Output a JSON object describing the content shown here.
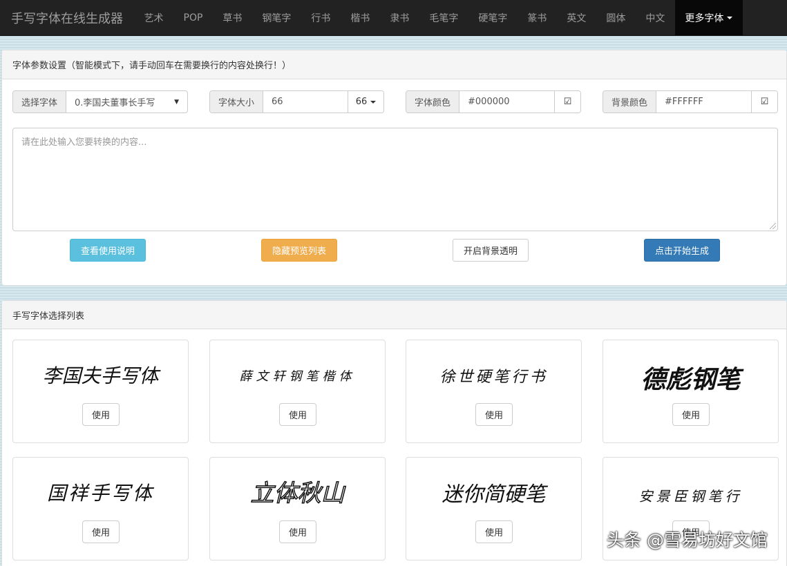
{
  "navbar": {
    "brand": "手写字体在线生成器",
    "items": [
      "艺术",
      "POP",
      "草书",
      "钢笔字",
      "行书",
      "楷书",
      "隶书",
      "毛笔字",
      "硬笔字",
      "篆书",
      "英文",
      "圆体",
      "中文"
    ],
    "more": "更多字体"
  },
  "settings": {
    "heading": "字体参数设置（智能模式下，请手动回车在需要换行的内容处换行！）",
    "font_label": "选择字体",
    "font_value": "0.李国夫董事长手写",
    "size_label": "字体大小",
    "size_value": "66",
    "size_select": "66",
    "color_label": "字体颜色",
    "color_value": "#000000",
    "bg_label": "背景颜色",
    "bg_value": "#FFFFFF",
    "textarea_placeholder": "请在此处输入您要转换的内容...",
    "buttons": {
      "help": "查看使用说明",
      "hide_preview": "隐藏预览列表",
      "transparent": "开启背景透明",
      "generate": "点击开始生成"
    }
  },
  "font_list": {
    "heading": "手写字体选择列表",
    "use_label": "使用",
    "cards": [
      {
        "preview": "李国夫手写体"
      },
      {
        "preview": "薛文轩钢笔楷体"
      },
      {
        "preview": "徐世硬笔行书"
      },
      {
        "preview": "德彪钢笔"
      },
      {
        "preview": "国祥手写体"
      },
      {
        "preview": "立体秋山"
      },
      {
        "preview": "迷你简硬笔"
      },
      {
        "preview": "安景臣钢笔行"
      }
    ]
  },
  "watermark": "头条 @雪易坊好文馆"
}
